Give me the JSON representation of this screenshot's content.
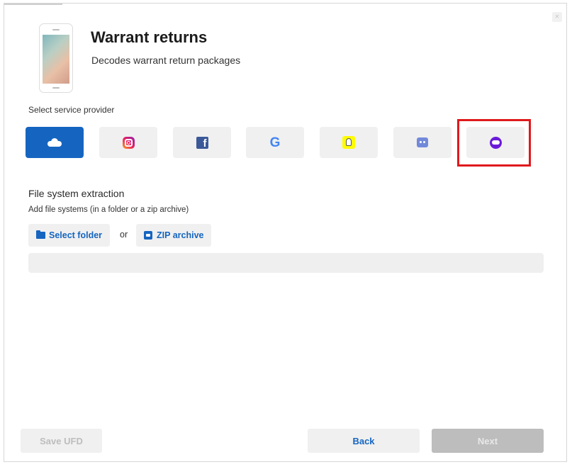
{
  "header": {
    "title": "Warrant returns",
    "subtitle": "Decodes warrant return packages"
  },
  "providers": {
    "label": "Select service provider",
    "items": [
      {
        "name": "cloud",
        "icon": "cloud-icon",
        "selected": true
      },
      {
        "name": "instagram",
        "icon": "instagram-icon",
        "selected": false
      },
      {
        "name": "facebook",
        "icon": "facebook-icon",
        "glyph": "f",
        "selected": false
      },
      {
        "name": "google",
        "icon": "google-icon",
        "glyph": "G",
        "selected": false
      },
      {
        "name": "snapchat",
        "icon": "snapchat-icon",
        "selected": false
      },
      {
        "name": "discord",
        "icon": "discord-icon",
        "selected": false
      },
      {
        "name": "purple-service",
        "icon": "purple-service-icon",
        "selected": false,
        "highlighted": true
      }
    ]
  },
  "filesystem": {
    "title": "File system extraction",
    "hint": "Add file systems (in a folder or a zip archive)",
    "select_folder_label": "Select folder",
    "or_label": "or",
    "zip_label": "ZIP archive"
  },
  "footer": {
    "save_label": "Save UFD",
    "back_label": "Back",
    "next_label": "Next"
  },
  "colors": {
    "accent": "#1565c0",
    "highlight": "#e0191c",
    "disabled": "#bdbdbd"
  }
}
